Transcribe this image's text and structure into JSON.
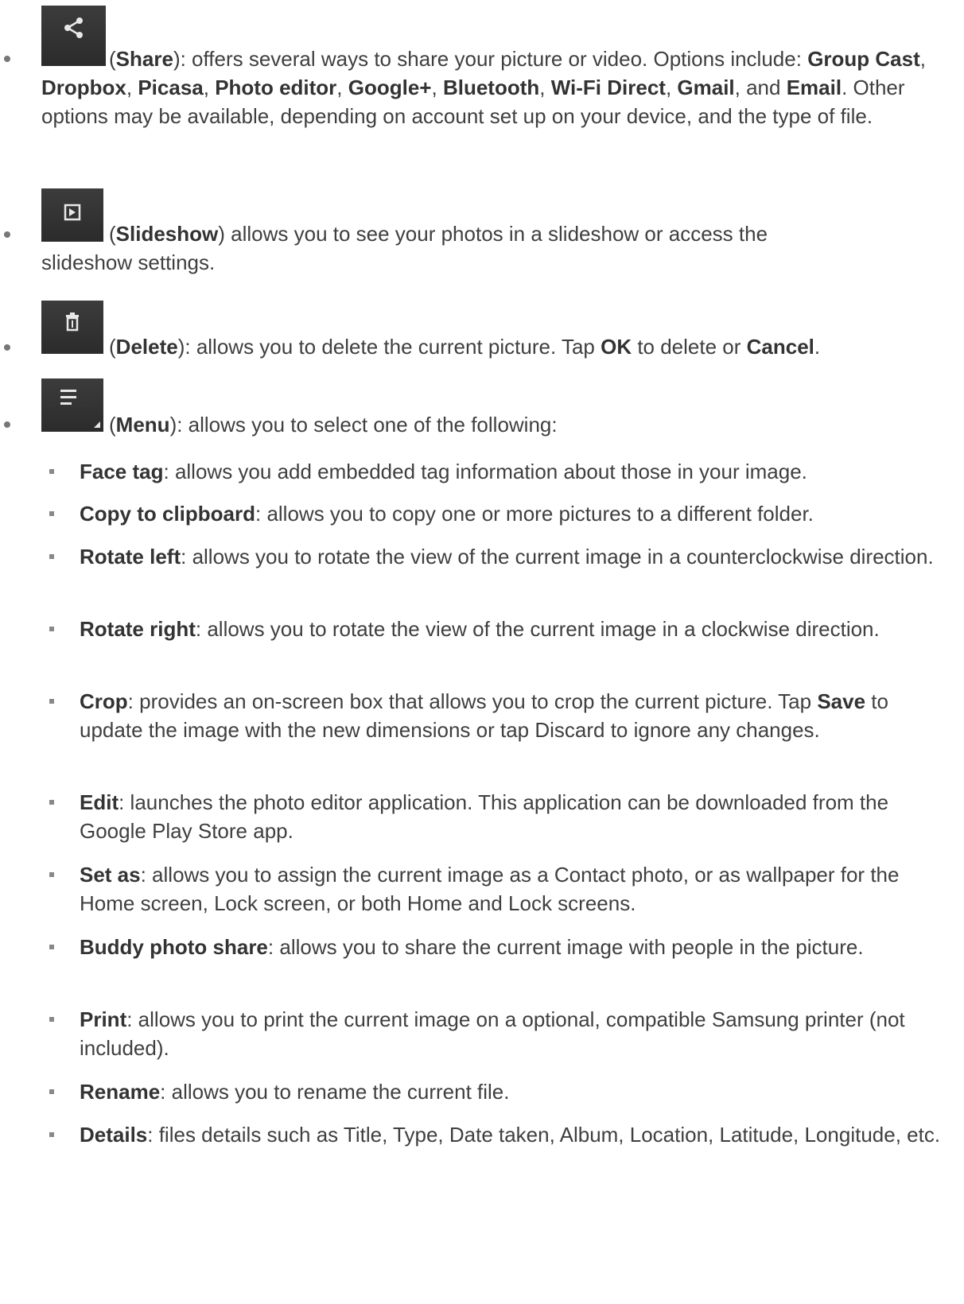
{
  "share": {
    "icon": "share-icon",
    "name": "Share",
    "desc1": "): offers several ways to share your picture or video. Options include:",
    "opt1": "Group Cast",
    "opt2": "Dropbox",
    "opt3": "Picasa",
    "opt4": "Photo editor",
    "opt5": "Google+",
    "opt6": "Bluetooth",
    "opt7": "Wi-Fi Direct",
    "opt8": "Gmail",
    "opt9": "Email",
    "tail": ". Other options may be available, depending on account set up on your device, and the type of file."
  },
  "slideshow": {
    "icon": "play-icon",
    "name": "Slideshow",
    "desc1": ") allows you to see your photos in  a slideshow or access the",
    "desc2": "slideshow settings."
  },
  "delete": {
    "icon": "trash-icon",
    "name": "Delete",
    "desc1": "): allows you to delete the current picture. Tap ",
    "ok": "OK",
    "mid": " to delete or ",
    "cancel": "Cancel",
    "end": "."
  },
  "menu": {
    "icon": "menu-icon",
    "name": "Menu",
    "desc": "): allows you to select one of the following:",
    "items": [
      {
        "term": "Face tag",
        "text": ": allows you add embedded tag information about those in your image."
      },
      {
        "term": "Copy to clipboard",
        "text": ": allows you to copy one or more pictures to a different folder."
      },
      {
        "term": "Rotate left",
        "text": ": allows you to rotate the view of the current image in a counterclockwise direction."
      },
      {
        "term": "Rotate right",
        "text": ": allows you to rotate the view of the current image in a clockwise direction."
      },
      {
        "term": "Crop",
        "text": ": provides an on-screen box that allows you to crop the current picture. Tap ",
        "term2": "Save",
        "text2": " to update the image with the new dimensions or tap Discard to ignore any changes."
      },
      {
        "term": "Edit",
        "text": ": launches the photo editor application. This application can be downloaded from the Google Play Store app."
      },
      {
        "term": "Set as",
        "text": ": allows you to assign the current image as a Contact photo, or as wallpaper for the Home screen, Lock screen, or both Home and Lock screens."
      },
      {
        "term": "Buddy photo share",
        "text": ": allows you to share the current image with people in the picture."
      },
      {
        "term": "Print",
        "text": ": allows you to print the current image on a optional, compatible Samsung printer (not included)."
      },
      {
        "term": "Rename",
        "text": ": allows you to rename the current file."
      },
      {
        "term": "Details",
        "text": ": files details such as Title, Type, Date taken, Album, Location, Latitude, Longitude, etc."
      }
    ]
  }
}
